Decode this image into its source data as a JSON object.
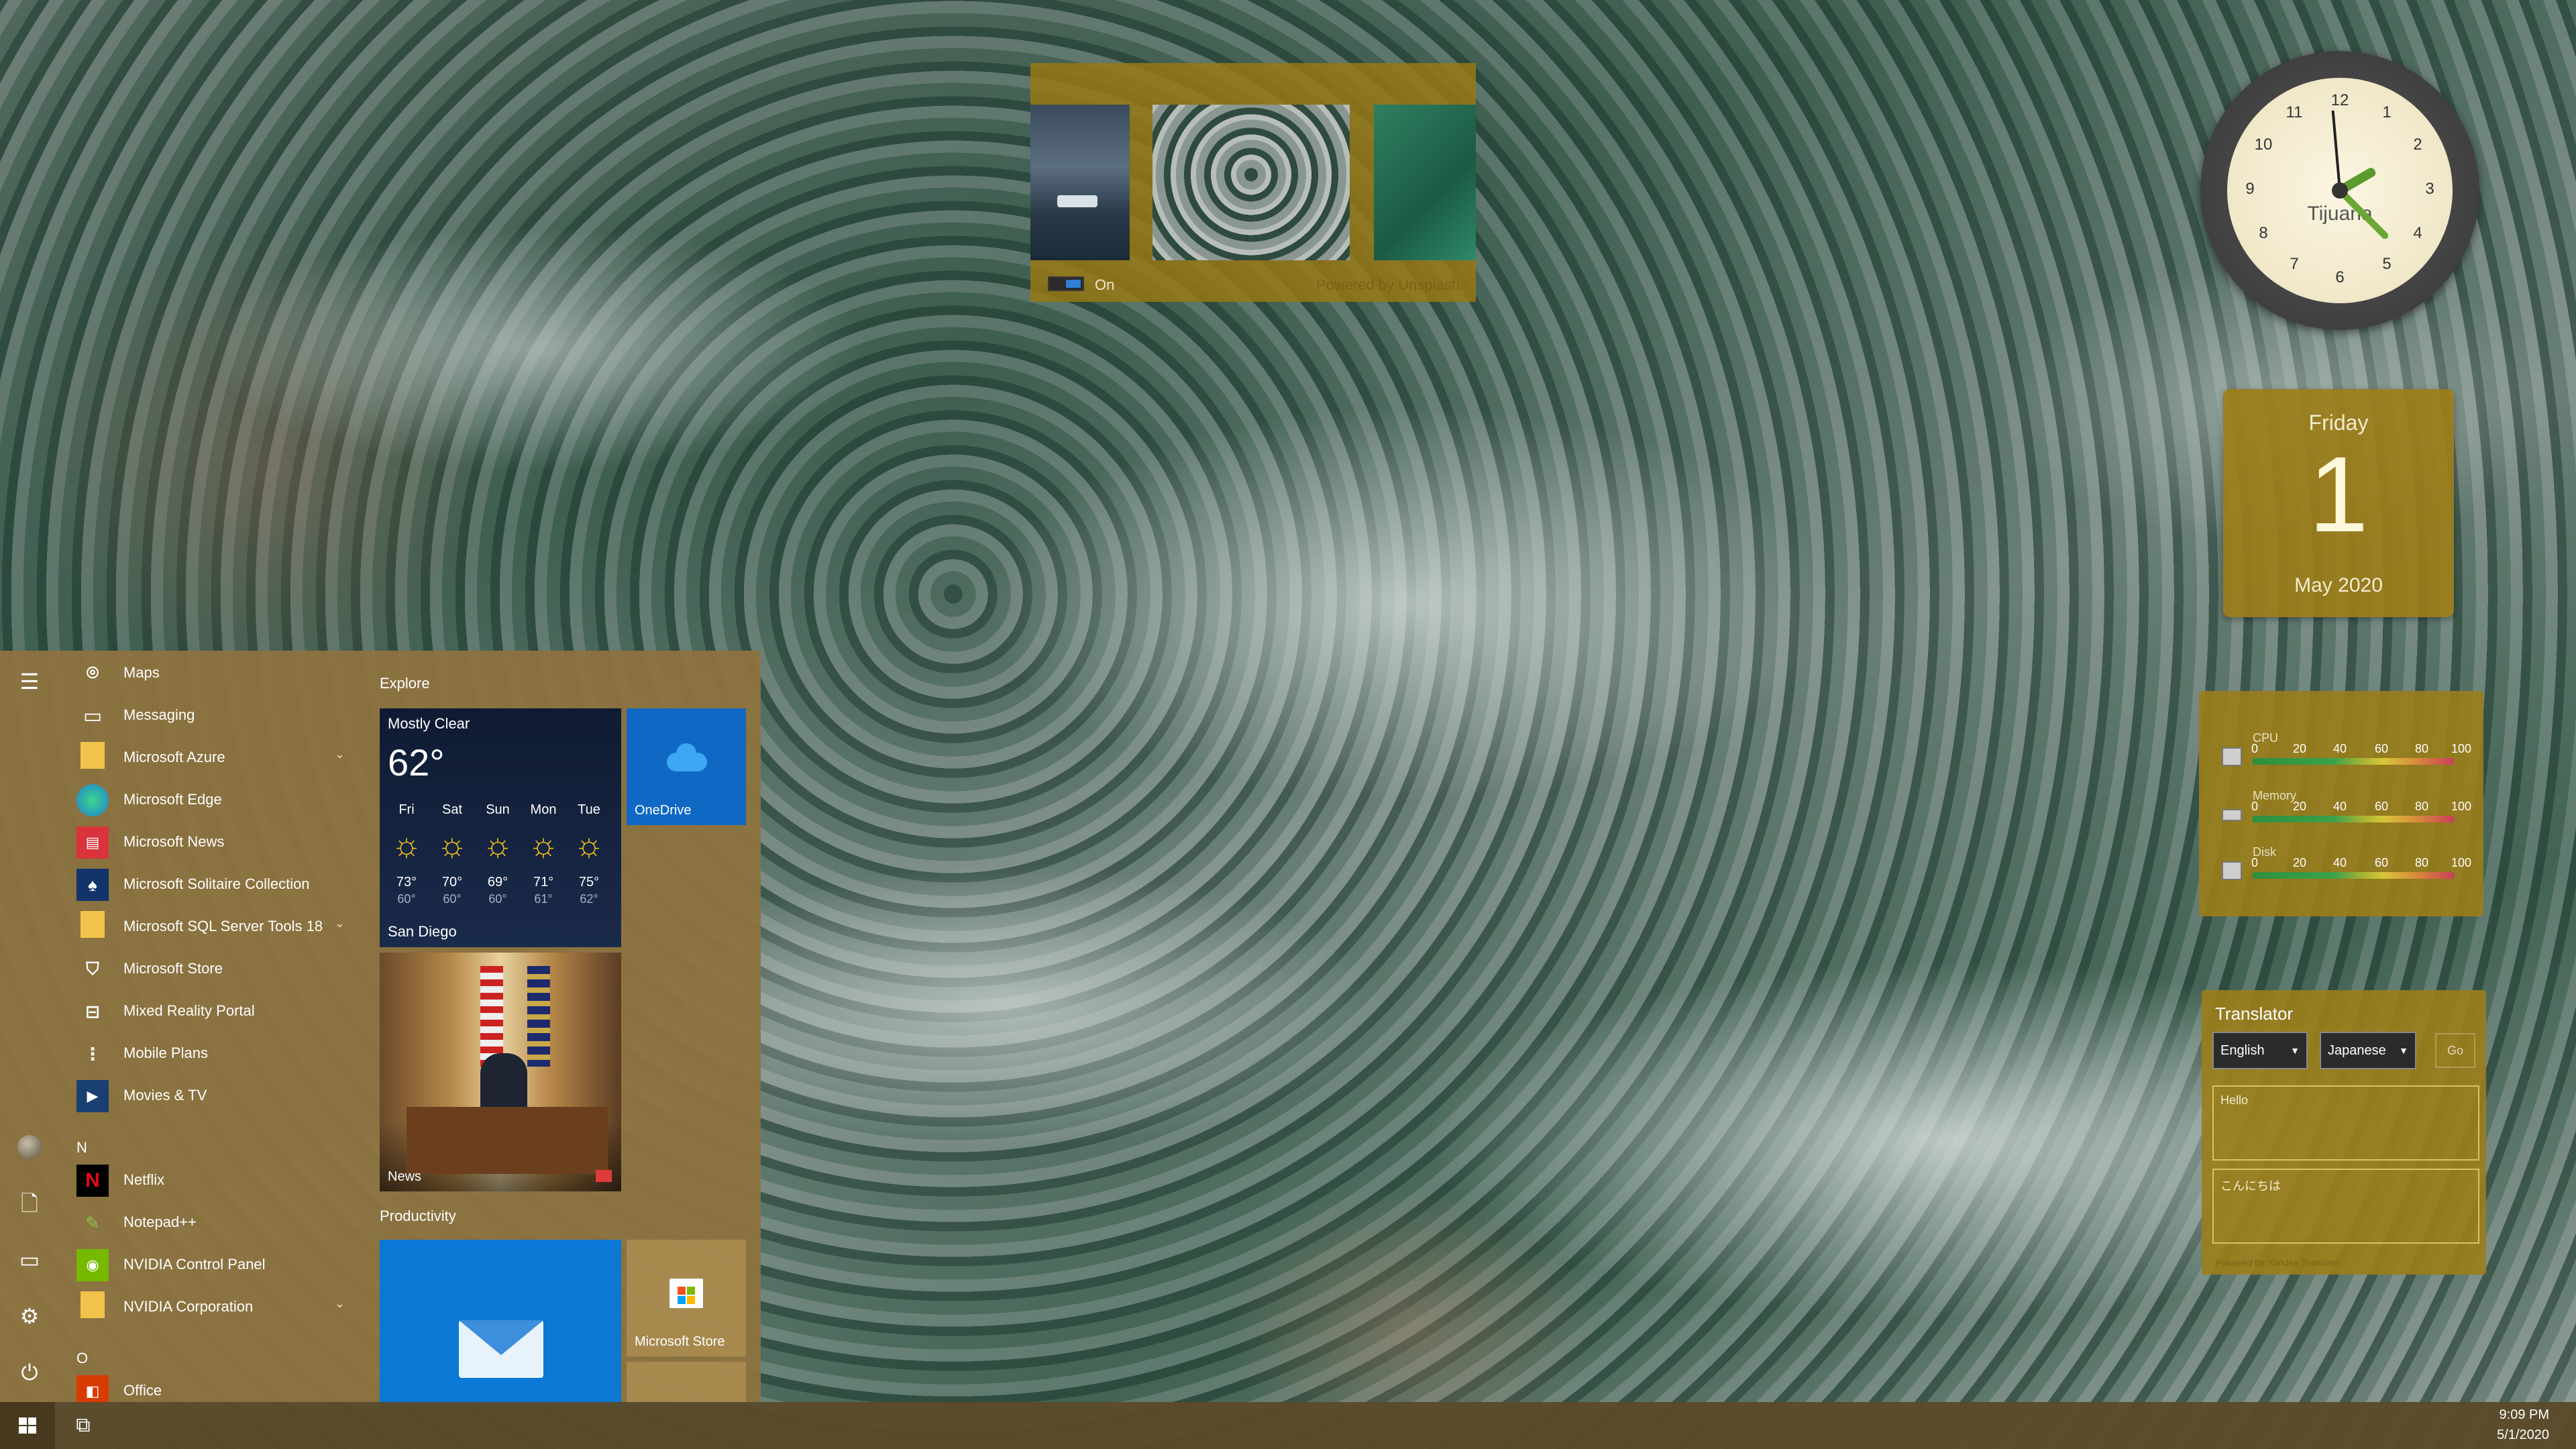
{
  "slideshow": {
    "toggle_label": "On",
    "powered_by": "Powered by Unsplash"
  },
  "clock": {
    "city": "Tijuana",
    "numbers": [
      "12",
      "1",
      "2",
      "3",
      "4",
      "5",
      "6",
      "7",
      "8",
      "9",
      "10",
      "11"
    ]
  },
  "calendar": {
    "weekday": "Friday",
    "day": "1",
    "month_year": "May 2020"
  },
  "system_monitor": {
    "scale": [
      "0",
      "20",
      "40",
      "60",
      "80",
      "100"
    ],
    "rows": [
      {
        "label": "CPU"
      },
      {
        "label": "Memory"
      },
      {
        "label": "Disk"
      }
    ]
  },
  "translator": {
    "title": "Translator",
    "source_lang": "English",
    "target_lang": "Japanese",
    "go_label": "Go",
    "input_text": "Hello",
    "output_text": "こんにちは",
    "powered_by": "Powered by Yandex.Translate"
  },
  "start_menu": {
    "apps": [
      {
        "label": "Maps",
        "icon": "maps-icon"
      },
      {
        "label": "Messaging",
        "icon": "messaging-icon"
      },
      {
        "label": "Microsoft Azure",
        "icon": "folder-icon",
        "expandable": true
      },
      {
        "label": "Microsoft Edge",
        "icon": "edge-icon"
      },
      {
        "label": "Microsoft News",
        "icon": "news-icon"
      },
      {
        "label": "Microsoft Solitaire Collection",
        "icon": "cards-icon"
      },
      {
        "label": "Microsoft SQL Server Tools 18",
        "icon": "folder-icon",
        "expandable": true
      },
      {
        "label": "Microsoft Store",
        "icon": "store-icon"
      },
      {
        "label": "Mixed Reality Portal",
        "icon": "headset-icon"
      },
      {
        "label": "Mobile Plans",
        "icon": "signal-icon"
      },
      {
        "label": "Movies & TV",
        "icon": "play-icon"
      }
    ],
    "letter_n": "N",
    "apps_n": [
      {
        "label": "Netflix",
        "icon": "netflix-icon"
      },
      {
        "label": "Notepad++",
        "icon": "notepad-icon"
      },
      {
        "label": "NVIDIA Control Panel",
        "icon": "nvidia-icon"
      },
      {
        "label": "NVIDIA Corporation",
        "icon": "folder-icon",
        "expandable": true
      }
    ],
    "letter_o": "O",
    "apps_o": [
      {
        "label": "Office",
        "icon": "office-icon"
      }
    ],
    "groups": {
      "explore": "Explore",
      "productivity": "Productivity"
    },
    "weather": {
      "condition": "Mostly Clear",
      "temp": "62°",
      "city": "San Diego",
      "forecast": [
        {
          "day": "Fri",
          "hi": "73°",
          "lo": "60°"
        },
        {
          "day": "Sat",
          "hi": "70°",
          "lo": "60°"
        },
        {
          "day": "Sun",
          "hi": "69°",
          "lo": "60°"
        },
        {
          "day": "Mon",
          "hi": "71°",
          "lo": "61°"
        },
        {
          "day": "Tue",
          "hi": "75°",
          "lo": "62°"
        }
      ]
    },
    "onedrive_label": "OneDrive",
    "news_label": "News",
    "store_label": "Microsoft Store"
  },
  "taskbar": {
    "time": "9:09 PM",
    "date": "5/1/2020"
  },
  "colors": {
    "accent": "#9b7d19",
    "start_bg": "#8c7240",
    "taskbar": "#5a4a2a"
  }
}
